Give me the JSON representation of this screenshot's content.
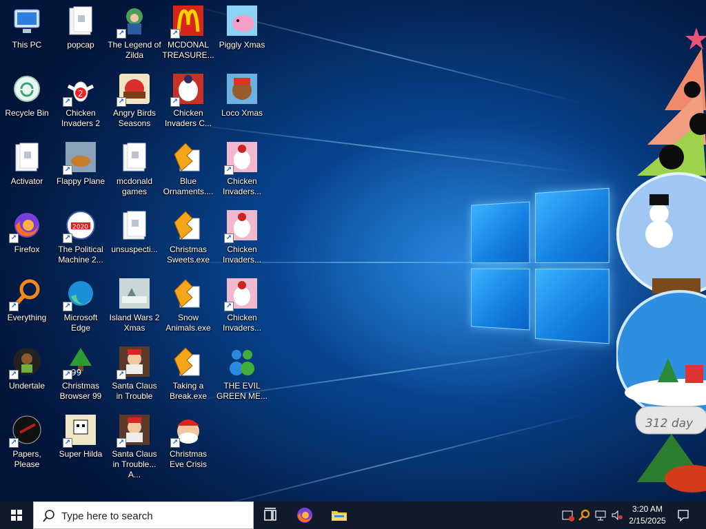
{
  "desktop": {
    "icons": [
      {
        "label": "This PC",
        "icon": "this-pc-icon",
        "shortcut": false
      },
      {
        "label": "popcap",
        "icon": "folder-icon",
        "shortcut": false
      },
      {
        "label": "The Legend of Zilda",
        "icon": "legend-of-zilda-icon",
        "shortcut": true
      },
      {
        "label": "MCDONAL TREASURE...",
        "icon": "mcdonald-treasure-icon",
        "shortcut": true
      },
      {
        "label": "Piggly Xmas",
        "icon": "piggly-xmas-icon",
        "shortcut": false
      },
      {
        "label": "Recycle Bin",
        "icon": "recycle-bin-icon",
        "shortcut": false
      },
      {
        "label": "Chicken Invaders 2",
        "icon": "chicken-invaders-2-icon",
        "shortcut": true
      },
      {
        "label": "Angry Birds Seasons",
        "icon": "angry-birds-seasons-icon",
        "shortcut": true
      },
      {
        "label": "Chicken Invaders C...",
        "icon": "chicken-invaders-christmas-icon",
        "shortcut": true
      },
      {
        "label": "Loco Xmas",
        "icon": "loco-xmas-icon",
        "shortcut": false
      },
      {
        "label": "Activator",
        "icon": "folder-icon",
        "shortcut": false
      },
      {
        "label": "Flappy Plane",
        "icon": "flappy-plane-icon",
        "shortcut": true
      },
      {
        "label": "mcdonald games",
        "icon": "folder-icon",
        "shortcut": false
      },
      {
        "label": "Blue Ornaments....",
        "icon": "exe-app-icon",
        "shortcut": false
      },
      {
        "label": "Chicken Invaders...",
        "icon": "chicken-invaders-icon",
        "shortcut": true
      },
      {
        "label": "Firefox",
        "icon": "firefox-icon",
        "shortcut": true
      },
      {
        "label": "The Political Machine 2...",
        "icon": "political-machine-icon",
        "shortcut": true
      },
      {
        "label": "unsuspecti...",
        "icon": "folder-icon",
        "shortcut": false
      },
      {
        "label": "Christmas Sweets.exe",
        "icon": "exe-app-icon",
        "shortcut": false
      },
      {
        "label": "Chicken Invaders...",
        "icon": "chicken-invaders-icon",
        "shortcut": true
      },
      {
        "label": "Everything",
        "icon": "everything-search-icon",
        "shortcut": true
      },
      {
        "label": "Microsoft Edge",
        "icon": "edge-icon",
        "shortcut": true
      },
      {
        "label": "Island Wars 2 Xmas",
        "icon": "island-wars-icon",
        "shortcut": false
      },
      {
        "label": "Snow Animals.exe",
        "icon": "exe-app-icon",
        "shortcut": false
      },
      {
        "label": "Chicken Invaders...",
        "icon": "chicken-invaders-icon",
        "shortcut": true
      },
      {
        "label": "Undertale",
        "icon": "undertale-icon",
        "shortcut": true
      },
      {
        "label": "Christmas Browser 99",
        "icon": "christmas-browser-icon",
        "shortcut": true
      },
      {
        "label": "Santa Claus in Trouble",
        "icon": "santa-claus-icon",
        "shortcut": true
      },
      {
        "label": "Taking a Break.exe",
        "icon": "exe-app-icon",
        "shortcut": false
      },
      {
        "label": "THE EVIL GREEN ME...",
        "icon": "messenger-icon",
        "shortcut": false
      },
      {
        "label": "Papers, Please",
        "icon": "papers-please-icon",
        "shortcut": true
      },
      {
        "label": "Super Hilda",
        "icon": "super-hilda-icon",
        "shortcut": true
      },
      {
        "label": "Santa Claus in Trouble... A...",
        "icon": "santa-claus-icon",
        "shortcut": true
      },
      {
        "label": "Christmas Eve Crisis",
        "icon": "santa-face-icon",
        "shortcut": true
      }
    ],
    "right_decor": {
      "globe_text": "312 day"
    }
  },
  "taskbar": {
    "search_placeholder": "Type here to search",
    "clock_time": "3:20 AM",
    "clock_date": "2/15/2025",
    "pinned": [
      "task-view-icon",
      "firefox-icon",
      "file-explorer-icon"
    ]
  }
}
